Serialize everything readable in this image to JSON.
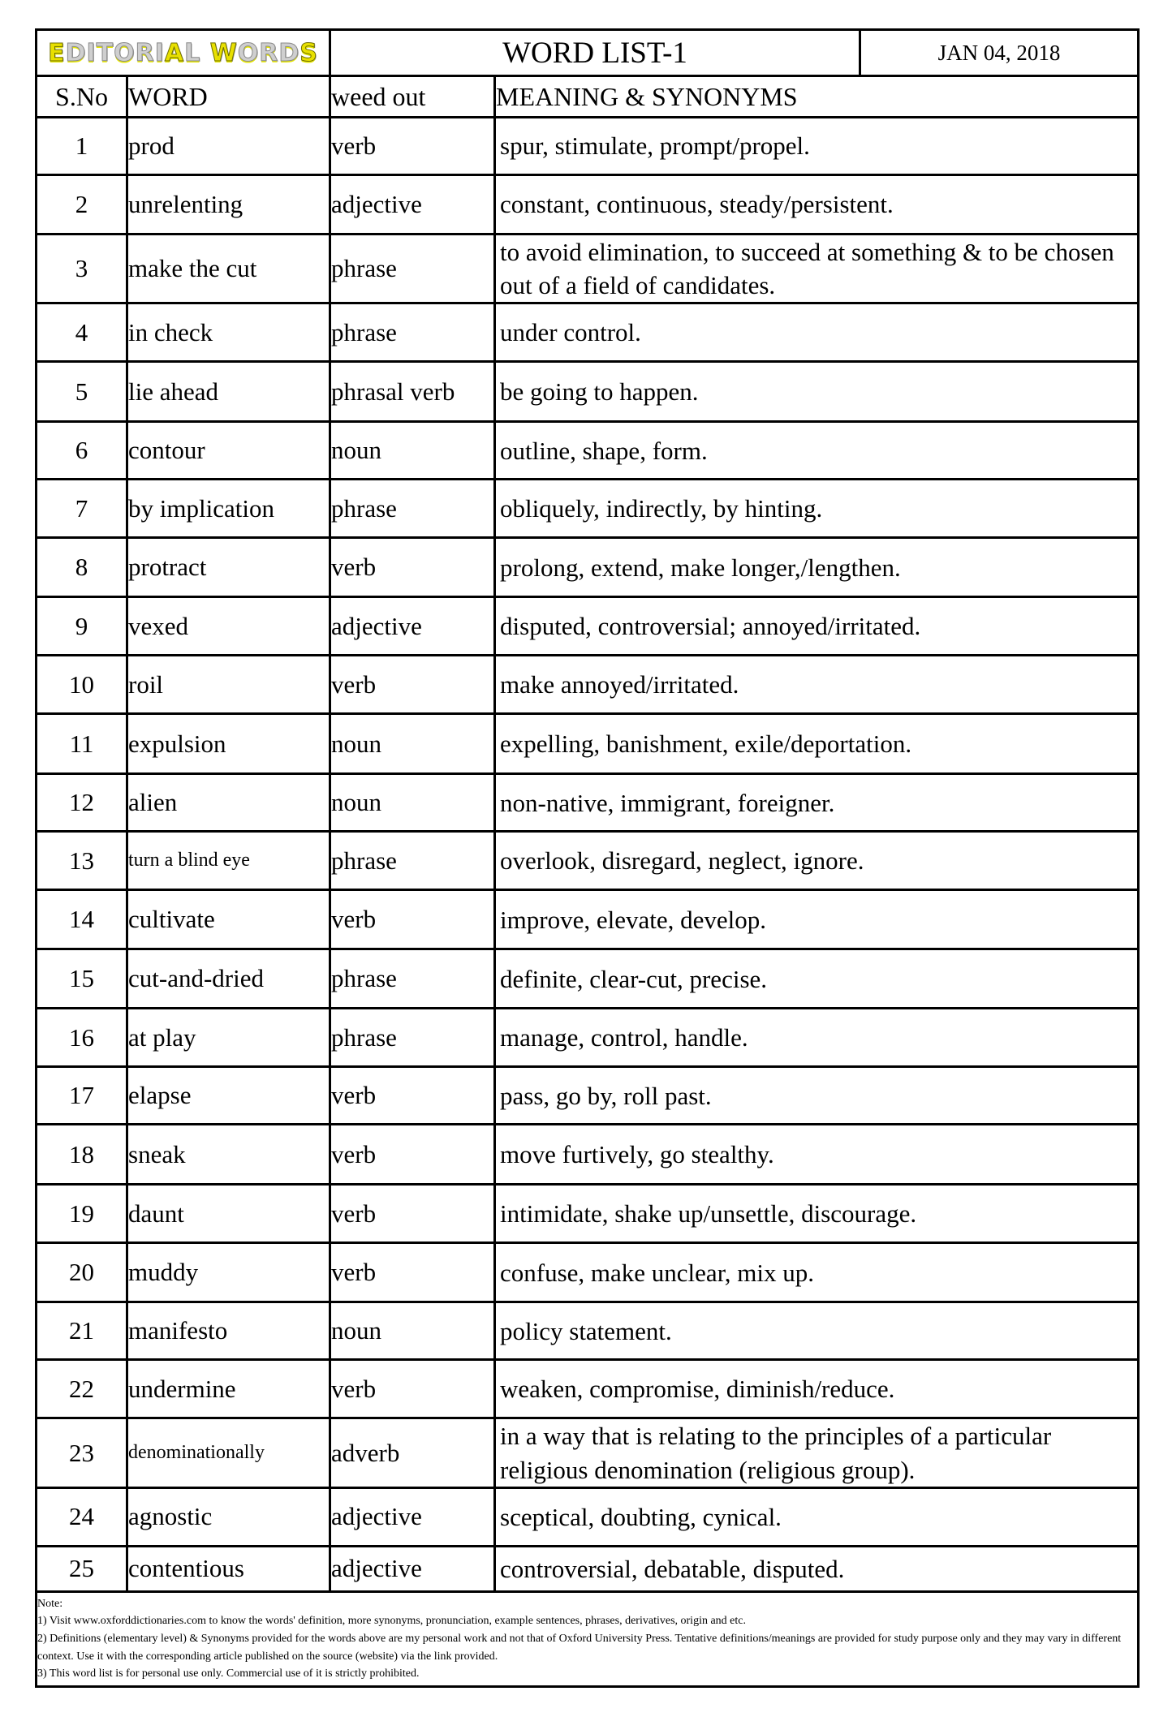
{
  "header": {
    "logo_text_parts": [
      {
        "text": "E",
        "accent": true
      },
      {
        "text": "DITORI",
        "accent": false
      },
      {
        "text": "A",
        "accent": true
      },
      {
        "text": "L ",
        "accent": false
      },
      {
        "text": "W",
        "accent": true
      },
      {
        "text": "ORD",
        "accent": false
      },
      {
        "text": "S",
        "accent": true
      }
    ],
    "title": "WORD LIST-1",
    "date": "JAN 04, 2018"
  },
  "columns": {
    "sno": "S.No",
    "word": "WORD",
    "type": "weed out",
    "meaning": "MEANING & SYNONYMS"
  },
  "rows": [
    {
      "sno": "1",
      "word": "prod",
      "type": "verb",
      "meaning": "spur, stimulate, prompt/propel."
    },
    {
      "sno": "2",
      "word": "unrelenting",
      "type": "adjective",
      "meaning": "constant, continuous, steady/persistent."
    },
    {
      "sno": "3",
      "word": "make the cut",
      "type": "phrase",
      "meaning": "to avoid elimination, to succeed at something & to be chosen out of a field of candidates."
    },
    {
      "sno": "4",
      "word": "in check",
      "type": "phrase",
      "meaning": "under control."
    },
    {
      "sno": "5",
      "word": "lie ahead",
      "type": "phrasal verb",
      "meaning": "be going to happen."
    },
    {
      "sno": "6",
      "word": "contour",
      "type": "noun",
      "meaning": "outline, shape, form."
    },
    {
      "sno": "7",
      "word": "by implication",
      "type": "phrase",
      "meaning": "obliquely, indirectly, by hinting."
    },
    {
      "sno": "8",
      "word": "protract",
      "type": "verb",
      "meaning": "prolong, extend, make longer,/lengthen."
    },
    {
      "sno": "9",
      "word": "vexed",
      "type": "adjective",
      "meaning": "disputed, controversial; annoyed/irritated."
    },
    {
      "sno": "10",
      "word": "roil",
      "type": "verb",
      "meaning": "make annoyed/irritated."
    },
    {
      "sno": "11",
      "word": "expulsion",
      "type": "noun",
      "meaning": "expelling, banishment, exile/deportation."
    },
    {
      "sno": "12",
      "word": "alien",
      "type": "noun",
      "meaning": "non-native, immigrant, foreigner."
    },
    {
      "sno": "13",
      "word": "turn a blind eye",
      "type": "phrase",
      "meaning": "overlook, disregard, neglect, ignore."
    },
    {
      "sno": "14",
      "word": "cultivate",
      "type": "verb",
      "meaning": "improve, elevate, develop."
    },
    {
      "sno": "15",
      "word": "cut-and-dried",
      "type": "phrase",
      "meaning": "definite, clear-cut, precise."
    },
    {
      "sno": "16",
      "word": "at play",
      "type": "phrase",
      "meaning": "manage, control, handle."
    },
    {
      "sno": "17",
      "word": "elapse",
      "type": "verb",
      "meaning": "pass, go by, roll past."
    },
    {
      "sno": "18",
      "word": "sneak",
      "type": "verb",
      "meaning": "move furtively, go stealthy."
    },
    {
      "sno": "19",
      "word": "daunt",
      "type": "verb",
      "meaning": "intimidate, shake up/unsettle, discourage."
    },
    {
      "sno": "20",
      "word": "muddy",
      "type": "verb",
      "meaning": "confuse, make unclear, mix up."
    },
    {
      "sno": "21",
      "word": "manifesto",
      "type": "noun",
      "meaning": "policy statement."
    },
    {
      "sno": "22",
      "word": "undermine",
      "type": "verb",
      "meaning": "weaken, compromise, diminish/reduce."
    },
    {
      "sno": "23",
      "word": "denominationally",
      "type": "adverb",
      "meaning": "in a way that is relating to the principles of a particular religious denomination (religious group)."
    },
    {
      "sno": "24",
      "word": "agnostic",
      "type": "adjective",
      "meaning": "sceptical, doubting, cynical."
    },
    {
      "sno": "25",
      "word": "contentious",
      "type": "adjective",
      "meaning": "controversial, debatable, disputed."
    }
  ],
  "footer": {
    "label": "Note:",
    "notes": [
      "1) Visit www.oxforddictionaries.com to know the words' definition, more synonyms, pronunciation, example sentences, phrases, derivatives, origin and etc.",
      "2) Definitions (elementary level) & Synonyms provided for the words above are my personal work and not that of Oxford University Press. Tentative definitions/meanings are provided for study purpose only and they may vary in different context. Use it with the corresponding article published on the source (website) via the link provided.",
      "3) This word list is for personal use only. Commercial use of it is strictly prohibited."
    ]
  }
}
